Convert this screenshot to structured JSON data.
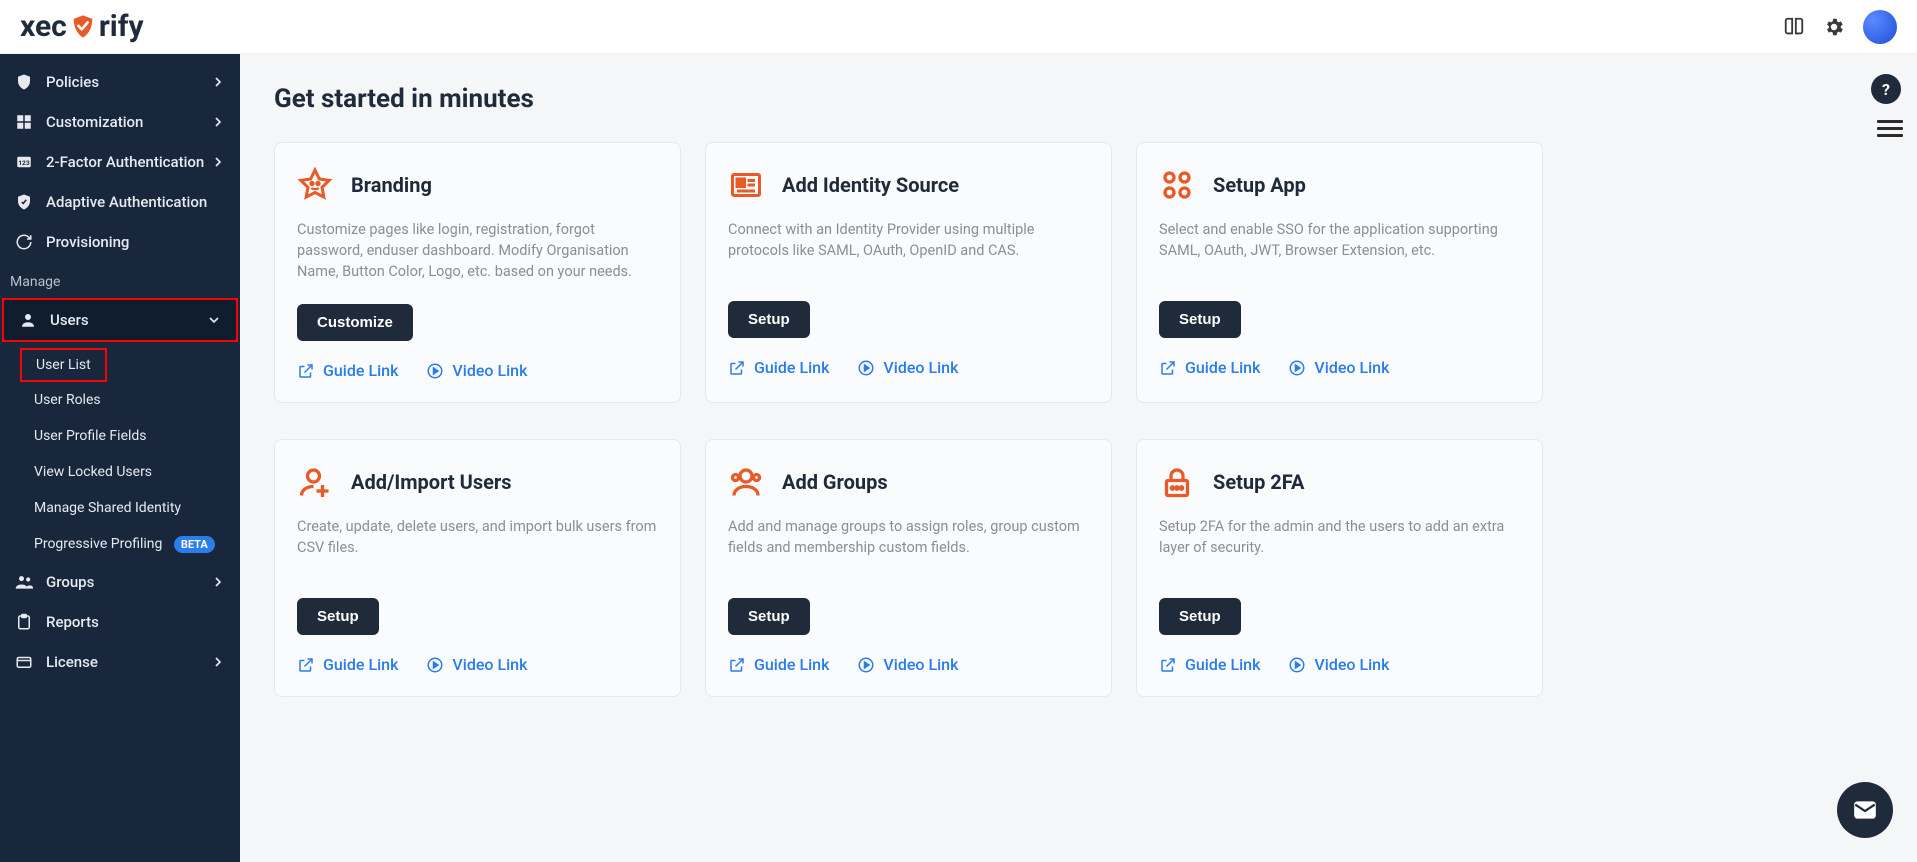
{
  "brand": {
    "name_pre": "xec",
    "name_post": "rify"
  },
  "sidebar": {
    "items": [
      {
        "label": "Policies"
      },
      {
        "label": "Customization"
      },
      {
        "label": "2-Factor Authentication"
      },
      {
        "label": "Adaptive Authentication"
      },
      {
        "label": "Provisioning"
      }
    ],
    "section_label": "Manage",
    "users": {
      "label": "Users",
      "sub": [
        {
          "label": "User List"
        },
        {
          "label": "User Roles"
        },
        {
          "label": "User Profile Fields"
        },
        {
          "label": "View Locked Users"
        },
        {
          "label": "Manage Shared Identity"
        },
        {
          "label": "Progressive Profiling",
          "beta": "BETA"
        }
      ]
    },
    "bottom": [
      {
        "label": "Groups"
      },
      {
        "label": "Reports"
      },
      {
        "label": "License"
      }
    ]
  },
  "main": {
    "title": "Get started in minutes",
    "cards": [
      {
        "title": "Branding",
        "desc": "Customize pages like login, registration, forgot password, enduser dashboard. Modify Organisation Name, Button Color, Logo, etc. based on your needs.",
        "btn": "Customize",
        "guide": "Guide Link",
        "video": "Video Link"
      },
      {
        "title": "Add Identity Source",
        "desc": "Connect with an Identity Provider using multiple protocols like SAML, OAuth, OpenID and CAS.",
        "btn": "Setup",
        "guide": "Guide Link",
        "video": "Video Link"
      },
      {
        "title": "Setup App",
        "desc": "Select and enable SSO for the application supporting SAML, OAuth, JWT, Browser Extension, etc.",
        "btn": "Setup",
        "guide": "Guide Link",
        "video": "Video Link"
      },
      {
        "title": "Add/Import Users",
        "desc": "Create, update, delete users, and import bulk users from CSV files.",
        "btn": "Setup",
        "guide": "Guide Link",
        "video": "Video Link"
      },
      {
        "title": "Add Groups",
        "desc": "Add and manage groups to assign roles, group custom fields and membership custom fields.",
        "btn": "Setup",
        "guide": "Guide Link",
        "video": "Video Link"
      },
      {
        "title": "Setup 2FA",
        "desc": "Setup 2FA for the admin and the users to add an extra layer of security.",
        "btn": "Setup",
        "guide": "Guide Link",
        "video": "Video Link"
      }
    ]
  },
  "float": {
    "help": "?",
    "mail": "✉"
  }
}
